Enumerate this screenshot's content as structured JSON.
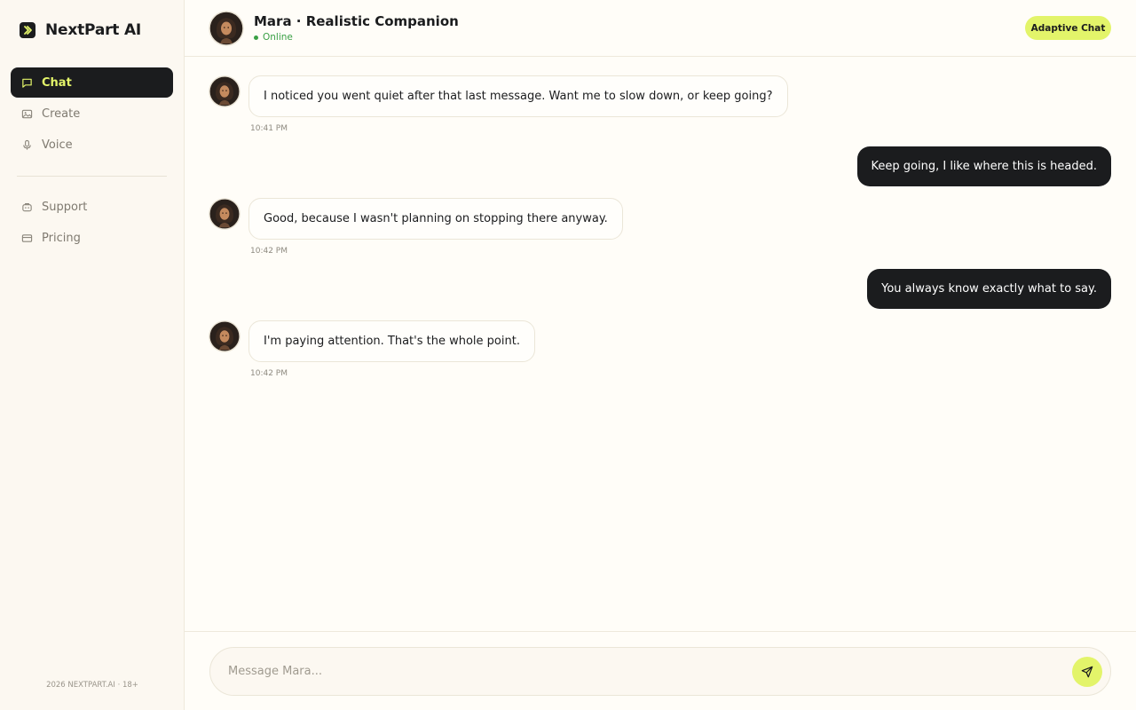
{
  "brand": {
    "name": "NextPart AI"
  },
  "nav": {
    "primary": [
      {
        "label": "Chat",
        "icon": "chat-icon",
        "active": true
      },
      {
        "label": "Create",
        "icon": "image-icon"
      },
      {
        "label": "Voice",
        "icon": "mic-icon"
      }
    ],
    "secondary": [
      {
        "label": "Support",
        "icon": "support-icon"
      },
      {
        "label": "Pricing",
        "icon": "card-icon"
      }
    ]
  },
  "footer": "2026 NEXTPART.AI · 18+",
  "header": {
    "title": "Mara · Realistic Companion",
    "status": "Online",
    "mode": "Adaptive Chat"
  },
  "messages": [
    {
      "from": "ai",
      "text": "I noticed you went quiet after that last message. Want me to slow down, or keep going?",
      "time": "10:41 PM"
    },
    {
      "from": "user",
      "text": "Keep going, I like where this is headed."
    },
    {
      "from": "ai",
      "text": "Good, because I wasn't planning on stopping there anyway.",
      "time": "10:42 PM"
    },
    {
      "from": "user",
      "text": "You always know exactly what to say."
    },
    {
      "from": "ai",
      "text": "I'm paying attention. That's the whole point.",
      "time": "10:42 PM"
    }
  ],
  "composer": {
    "placeholder": "Message Mara...",
    "value": ""
  },
  "colors": {
    "accent": "#e3f46a",
    "dark": "#1b1c1e",
    "online": "#3aa045",
    "background": "#fffdf8",
    "sidebar": "#fcf8f1"
  }
}
